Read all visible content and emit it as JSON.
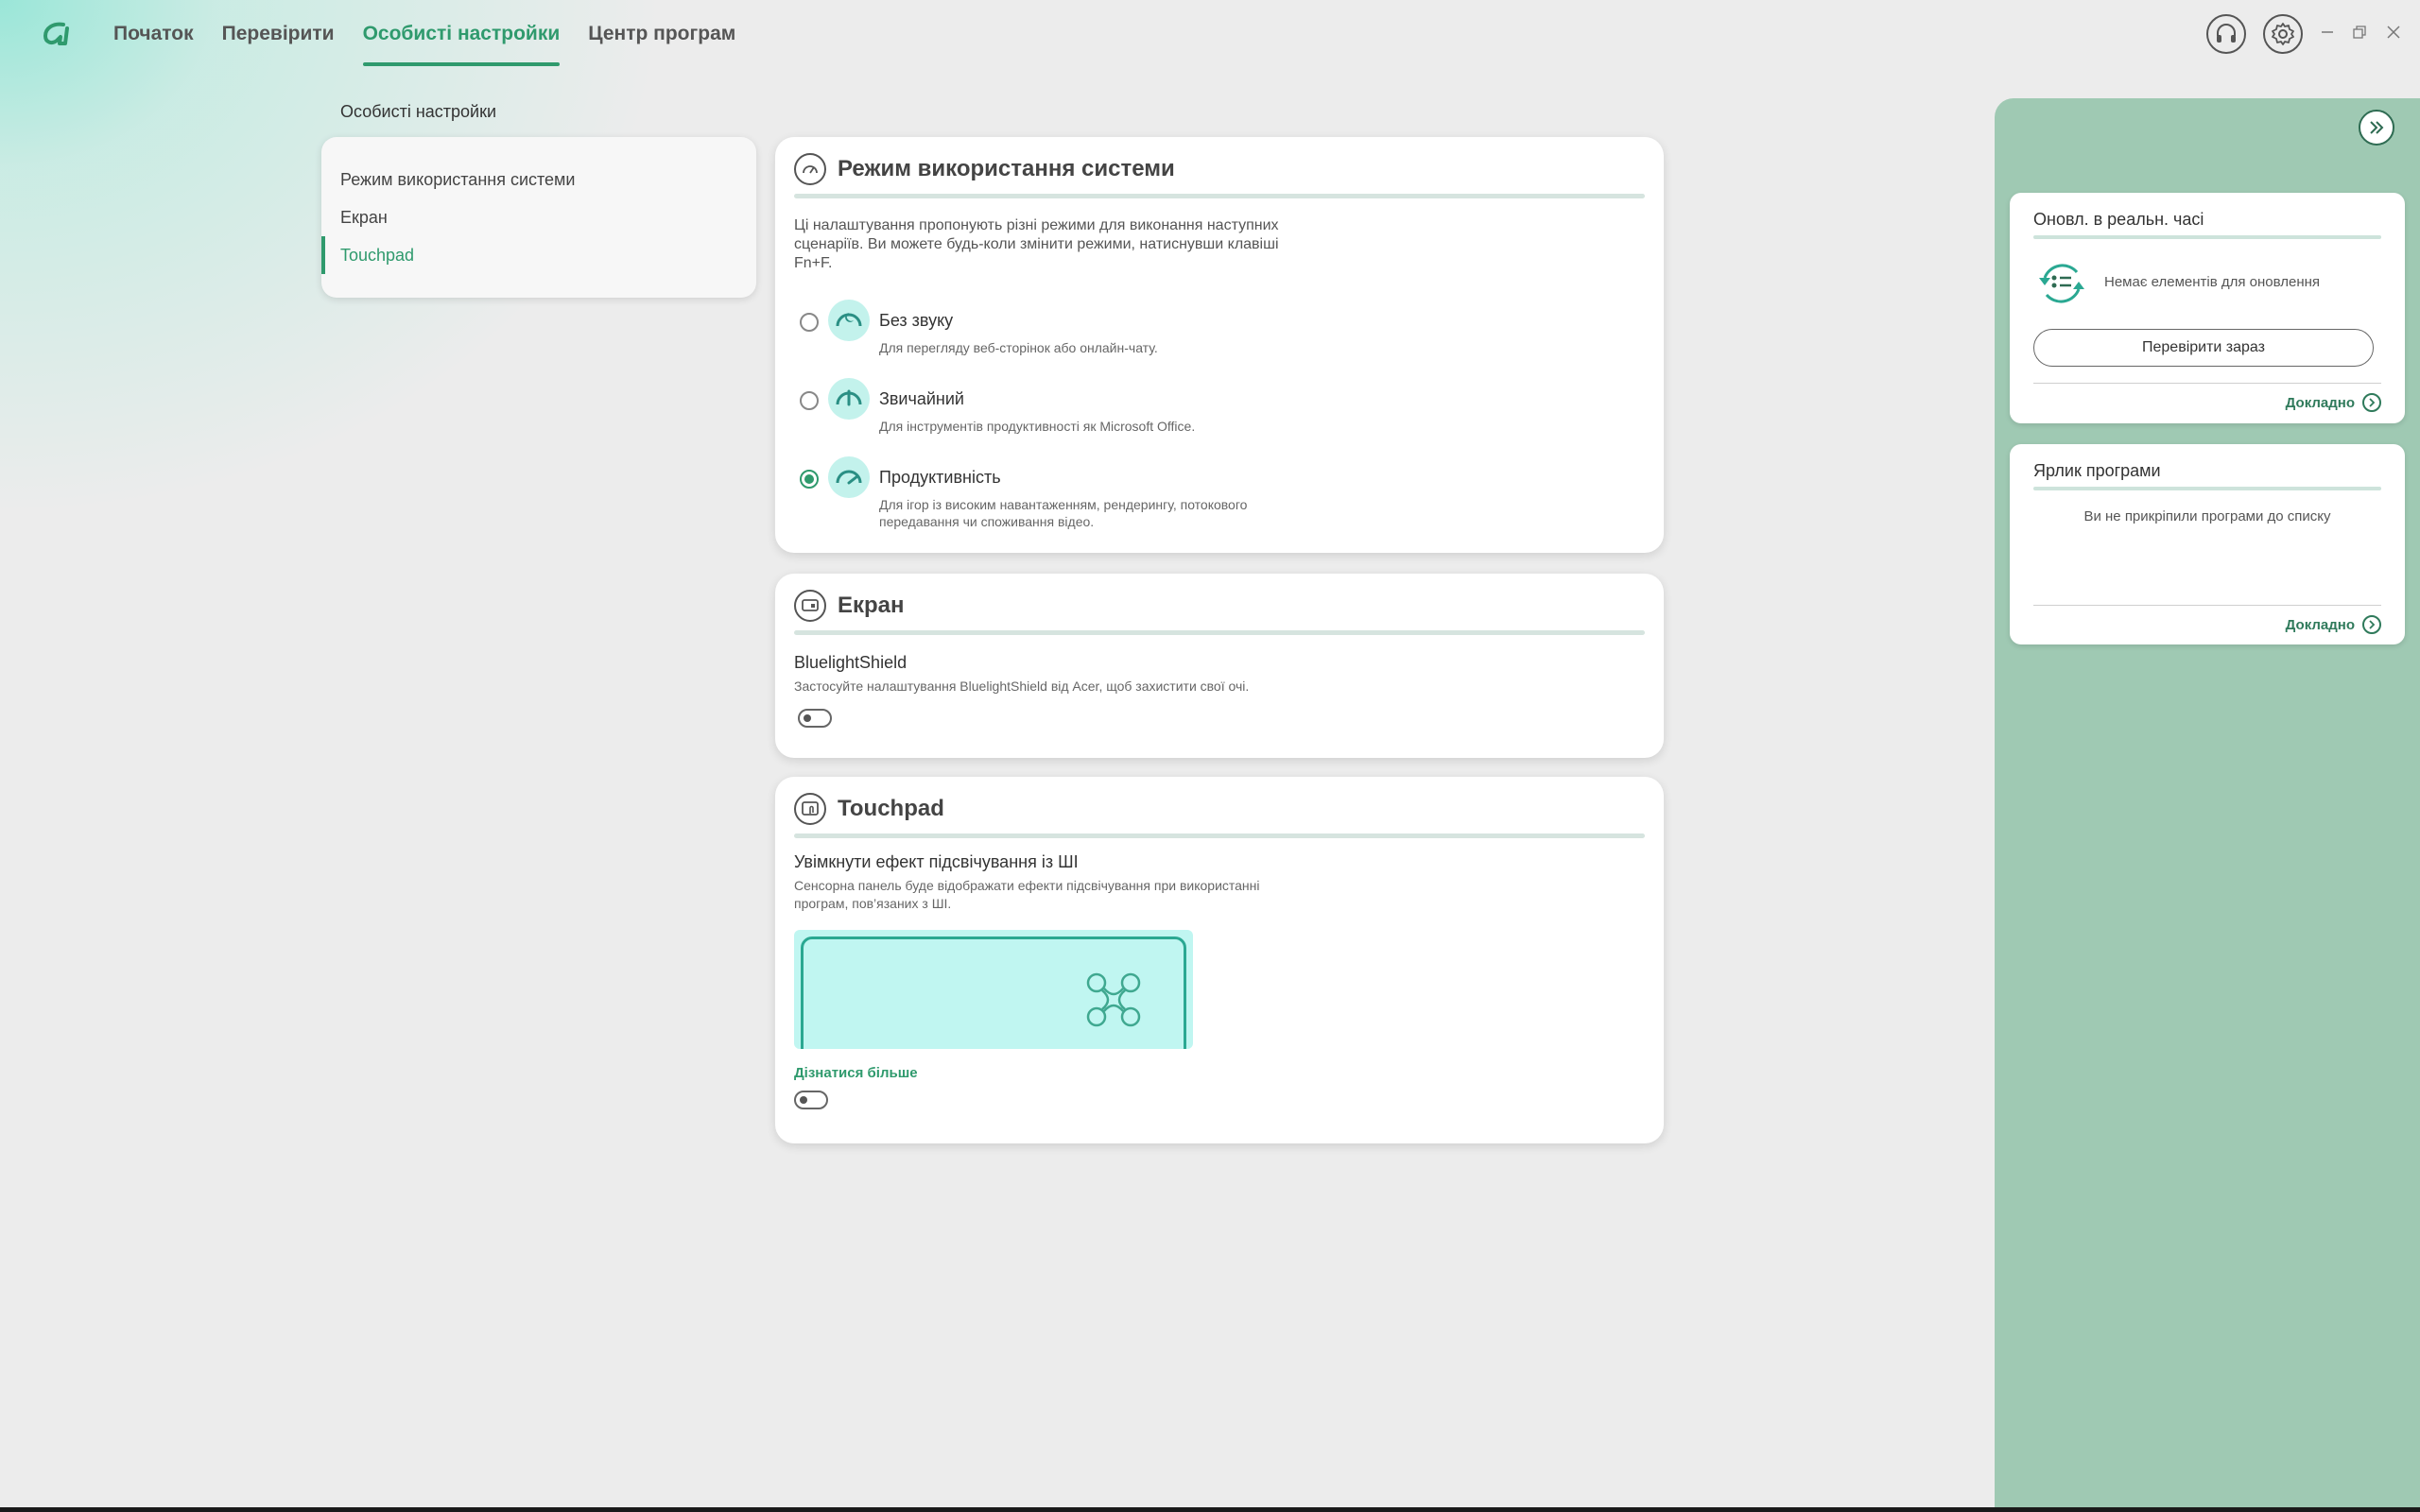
{
  "nav": {
    "items": [
      {
        "label": "Початок"
      },
      {
        "label": "Перевірити"
      },
      {
        "label": "Особисті настройки"
      },
      {
        "label": "Центр програм"
      }
    ],
    "active_index": 2
  },
  "page": {
    "title": "Особисті настройки"
  },
  "subnav": {
    "items": [
      {
        "label": "Режим використання системи"
      },
      {
        "label": "Екран"
      },
      {
        "label": "Touchpad"
      }
    ],
    "active_index": 2
  },
  "system_mode": {
    "title": "Режим використання системи",
    "description": "Ці налаштування пропонують різні режими для виконання наступних сценаріїв. Ви можете будь-коли змінити режими, натиснувши клавіші Fn+F.",
    "modes": [
      {
        "title": "Без звуку",
        "subtitle": "Для перегляду веб-сторінок або онлайн-чату.",
        "checked": false
      },
      {
        "title": "Звичайний",
        "subtitle": "Для інструментів продуктивності як Microsoft Office.",
        "checked": false
      },
      {
        "title": "Продуктивність",
        "subtitle": "Для ігор із високим навантаженням, рендерингу, потокового передавання чи споживання відео.",
        "checked": true
      }
    ]
  },
  "screen": {
    "title": "Екран",
    "bluelight_title": "BluelightShield",
    "bluelight_desc": "Застосуйте налаштування BluelightShield від Acer, щоб захистити свої очі.",
    "toggle_on": false
  },
  "touchpad": {
    "title": "Touchpad",
    "ai_title": "Увімкнути ефект підсвічування із ШІ",
    "ai_desc": "Сенсорна панель буде відображати ефекти підсвічування при використанні програм, пов’язаних з ШІ.",
    "learn_more": "Дізнатися більше",
    "toggle_on": false
  },
  "right_panel": {
    "updates": {
      "title": "Оновл. в реальн. часі",
      "empty_text": "Немає елементів для оновлення",
      "check_button": "Перевірити зараз",
      "more": "Докладно"
    },
    "shortcuts": {
      "title": "Ярлик програми",
      "empty_text": "Ви не прикріпили програми до списку",
      "more": "Докладно"
    }
  },
  "colors": {
    "accent": "#2f9a6d",
    "panel": "#9fc9b3",
    "mode_icon_bg": "#c3f2ec"
  }
}
